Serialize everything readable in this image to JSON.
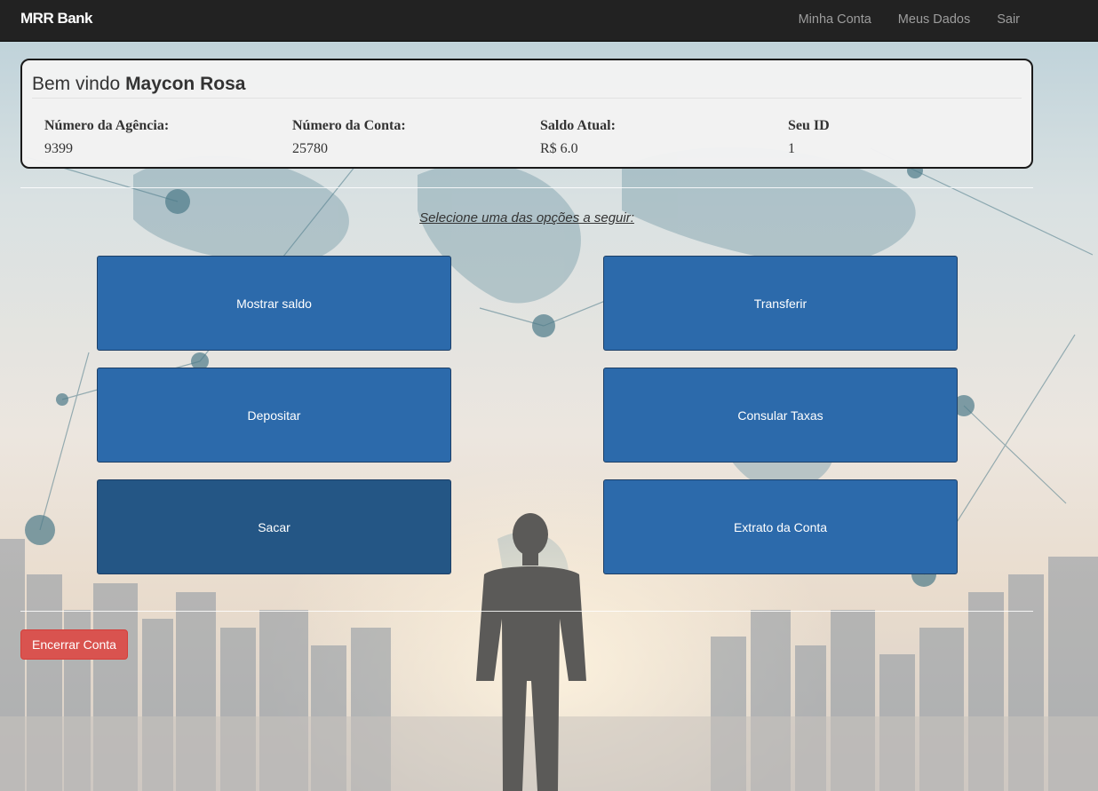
{
  "navbar": {
    "brand": "MRR Bank",
    "links": [
      "Minha Conta",
      "Meus Dados",
      "Sair"
    ]
  },
  "welcome": {
    "greeting": "Bem vindo",
    "user_name": "Maycon Rosa",
    "fields": [
      {
        "label": "Número da Agência:",
        "value": "9399"
      },
      {
        "label": "Número da Conta:",
        "value": "25780"
      },
      {
        "label": "Saldo Atual:",
        "value": "R$ 6.0"
      },
      {
        "label": "Seu ID",
        "value": "1"
      }
    ]
  },
  "prompt": "Selecione uma das opções a seguir:",
  "options": [
    {
      "label": "Mostrar saldo"
    },
    {
      "label": "Transferir"
    },
    {
      "label": "Depositar"
    },
    {
      "label": "Consular Taxas"
    },
    {
      "label": "Sacar"
    },
    {
      "label": "Extrato da Conta"
    }
  ],
  "close_account": "Encerrar Conta",
  "colors": {
    "navbar": "#222222",
    "option_button": "#2c6aab",
    "option_button_active": "#245685",
    "danger": "#d9534f"
  }
}
